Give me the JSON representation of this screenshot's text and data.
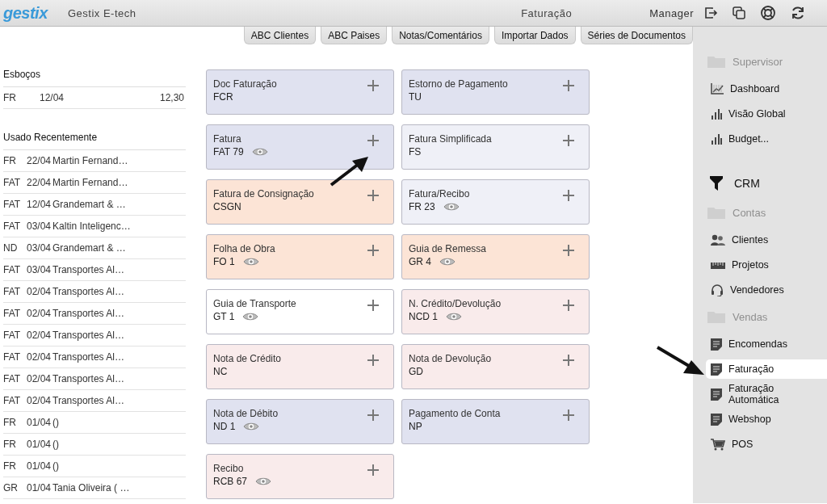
{
  "header": {
    "logo": "gestix",
    "company": "Gestix E-tech",
    "title": "Faturação",
    "user": "Manager"
  },
  "tabs": [
    {
      "label": "ABC Clientes"
    },
    {
      "label": "ABC Paises"
    },
    {
      "label": "Notas/Comentários"
    },
    {
      "label": "Importar Dados"
    },
    {
      "label": "Séries de Documentos"
    }
  ],
  "drafts": {
    "title": "Esboços",
    "rows": [
      {
        "type": "FR",
        "date": "12/04",
        "amount": "12,30"
      }
    ]
  },
  "recent": {
    "title": "Usado Recentemente",
    "rows": [
      {
        "type": "FR",
        "date": "22/04",
        "name": "Martin Fernand…"
      },
      {
        "type": "FAT",
        "date": "22/04",
        "name": "Martin Fernand…"
      },
      {
        "type": "FAT",
        "date": "12/04",
        "name": "Grandemart & …"
      },
      {
        "type": "FAT",
        "date": "03/04",
        "name": "Kaltin Inteligenc…"
      },
      {
        "type": "ND",
        "date": "03/04",
        "name": "Grandemart & …"
      },
      {
        "type": "FAT",
        "date": "03/04",
        "name": "Transportes Al…"
      },
      {
        "type": "FAT",
        "date": "02/04",
        "name": "Transportes Al…"
      },
      {
        "type": "FAT",
        "date": "02/04",
        "name": "Transportes Al…"
      },
      {
        "type": "FAT",
        "date": "02/04",
        "name": "Transportes Al…"
      },
      {
        "type": "FAT",
        "date": "02/04",
        "name": "Transportes Al…"
      },
      {
        "type": "FAT",
        "date": "02/04",
        "name": "Transportes Al…"
      },
      {
        "type": "FAT",
        "date": "02/04",
        "name": "Transportes Al…"
      },
      {
        "type": "FR",
        "date": "01/04",
        "name": "()"
      },
      {
        "type": "FR",
        "date": "01/04",
        "name": "()"
      },
      {
        "type": "FR",
        "date": "01/04",
        "name": "()"
      },
      {
        "type": "GR",
        "date": "01/04",
        "name": "Tania Oliveira ( …"
      }
    ]
  },
  "documents": [
    {
      "name": "Doc Faturação",
      "code": "FCR",
      "preview": false,
      "color": "#e0e2f0"
    },
    {
      "name": "Estorno de Pagamento",
      "code": "TU",
      "preview": false,
      "color": "#e0e2f0"
    },
    {
      "name": "Fatura",
      "code": "FAT 79",
      "preview": true,
      "color": "#e0e2f0"
    },
    {
      "name": "Fatura Simplificada",
      "code": "FS",
      "preview": false,
      "color": "#eff0f7"
    },
    {
      "name": "Fatura de Consignação",
      "code": "CSGN",
      "preview": false,
      "color": "#fce4d6"
    },
    {
      "name": "Fatura/Recibo",
      "code": "FR 23",
      "preview": true,
      "color": "#eff0f7"
    },
    {
      "name": "Folha de Obra",
      "code": "FO 1",
      "preview": true,
      "color": "#fce4d6"
    },
    {
      "name": "Guia de Remessa",
      "code": "GR 4",
      "preview": true,
      "color": "#fce4d6"
    },
    {
      "name": "Guia de Transporte",
      "code": "GT 1",
      "preview": true,
      "color": "#ffffff"
    },
    {
      "name": "N. Crédito/Devolução",
      "code": "NCD 1",
      "preview": true,
      "color": "#f9ebeb"
    },
    {
      "name": "Nota de Crédito",
      "code": "NC",
      "preview": false,
      "color": "#f9ebeb"
    },
    {
      "name": "Nota de Devolução",
      "code": "GD",
      "preview": false,
      "color": "#f9ebeb"
    },
    {
      "name": "Nota de Débito",
      "code": "ND 1",
      "preview": true,
      "color": "#e0e2f0"
    },
    {
      "name": "Pagamento de Conta",
      "code": "NP",
      "preview": false,
      "color": "#e0e2f0"
    },
    {
      "name": "Recibo",
      "code": "RCB 67",
      "preview": true,
      "color": "#f9ebeb"
    }
  ],
  "sidebar": [
    {
      "kind": "section",
      "label": "Supervisor"
    },
    {
      "kind": "item",
      "label": "Dashboard",
      "selected": false
    },
    {
      "kind": "item",
      "label": "Visão Global",
      "selected": false
    },
    {
      "kind": "item",
      "label": "Budget...",
      "selected": false
    },
    {
      "kind": "crm",
      "label": "CRM"
    },
    {
      "kind": "section",
      "label": "Contas"
    },
    {
      "kind": "item",
      "label": "Clientes",
      "selected": false
    },
    {
      "kind": "item",
      "label": "Projetos",
      "selected": false
    },
    {
      "kind": "item",
      "label": "Vendedores",
      "selected": false
    },
    {
      "kind": "section",
      "label": "Vendas"
    },
    {
      "kind": "item",
      "label": "Encomendas",
      "selected": false
    },
    {
      "kind": "item",
      "label": "Faturação",
      "selected": true
    },
    {
      "kind": "item",
      "label": "Faturação Automática",
      "selected": false
    },
    {
      "kind": "item",
      "label": "Webshop",
      "selected": false
    },
    {
      "kind": "item",
      "label": "POS",
      "selected": false
    }
  ]
}
